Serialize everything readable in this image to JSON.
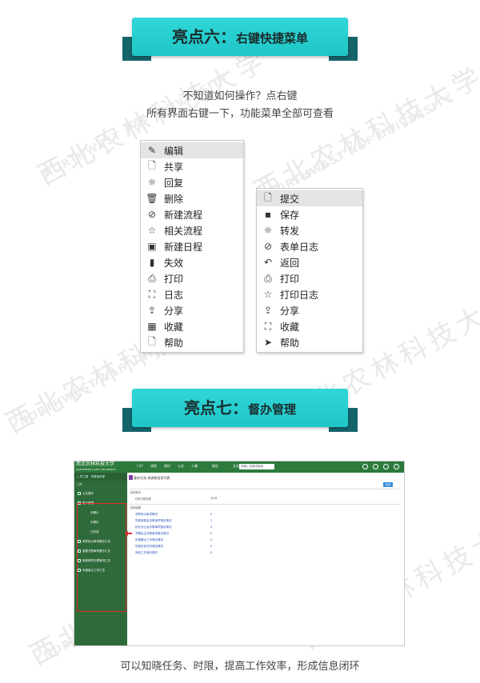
{
  "section6": {
    "title_big": "亮点六：",
    "title_small": "右键快捷菜单"
  },
  "caption6": {
    "line1": "不知道如何操作？点右键",
    "line2": "所有界面右键一下，功能菜单全部可查看"
  },
  "menu_left": [
    {
      "icon": "edit-icon",
      "glyph": "✎",
      "label": "编辑",
      "selected": true
    },
    {
      "icon": "document-icon",
      "glyph": "🗋",
      "label": "共享"
    },
    {
      "icon": "sun-icon",
      "glyph": "☼",
      "label": "回复"
    },
    {
      "icon": "trash-icon",
      "glyph": "🗑",
      "label": "删除"
    },
    {
      "icon": "tag-icon",
      "glyph": "⊘",
      "label": "新建流程"
    },
    {
      "icon": "star-icon",
      "glyph": "☆",
      "label": "相关流程"
    },
    {
      "icon": "window-icon",
      "glyph": "▣",
      "label": "新建日程"
    },
    {
      "icon": "bar-chart-icon",
      "glyph": "▮",
      "label": "失效"
    },
    {
      "icon": "printer-icon",
      "glyph": "⎙",
      "label": "打印"
    },
    {
      "icon": "log-icon",
      "glyph": "⛶",
      "label": "日志"
    },
    {
      "icon": "share-icon",
      "glyph": "⇪",
      "label": "分享"
    },
    {
      "icon": "calendar-icon",
      "glyph": "▦",
      "label": "收藏"
    },
    {
      "icon": "help-icon",
      "glyph": "🗋",
      "label": "帮助"
    }
  ],
  "menu_right": [
    {
      "icon": "submit-icon",
      "glyph": "🗋",
      "label": "提交",
      "selected": true
    },
    {
      "icon": "save-icon",
      "glyph": "▪",
      "label": "保存"
    },
    {
      "icon": "sun-icon",
      "glyph": "☼",
      "label": "转发"
    },
    {
      "icon": "tag-icon",
      "glyph": "⊘",
      "label": "表单日志"
    },
    {
      "icon": "return-icon",
      "glyph": "↶",
      "label": "返回"
    },
    {
      "icon": "printer-icon",
      "glyph": "⎙",
      "label": "打印"
    },
    {
      "icon": "star-icon",
      "glyph": "☆",
      "label": "打印日志"
    },
    {
      "icon": "share-icon",
      "glyph": "⇪",
      "label": "分享"
    },
    {
      "icon": "log-icon",
      "glyph": "⛶",
      "label": "收藏"
    },
    {
      "icon": "send-icon",
      "glyph": "➤",
      "label": "帮助"
    }
  ],
  "section7": {
    "title_big": "亮点七：",
    "title_small": "督办管理"
  },
  "app": {
    "nav": [
      "门户",
      "流程",
      "知识",
      "公文",
      "人事",
      "",
      "报告",
      "",
      "全文",
      "请输入关键词搜索"
    ],
    "side_header": "门户",
    "side_items": [
      {
        "label": "公文督办",
        "sub": false
      },
      {
        "label": "督办管理",
        "sub": false
      },
      {
        "label": "未确认",
        "sub": true
      },
      {
        "label": "办理中",
        "sub": true
      },
      {
        "label": "已完成",
        "sub": true
      },
      {
        "label": "领导批示事项督办汇总",
        "sub": false
      },
      {
        "label": "重要决策事项督办汇总",
        "sub": false
      },
      {
        "label": "网络事项办理情况汇总",
        "sub": false
      },
      {
        "label": "年度重点工作汇总",
        "sub": false
      }
    ],
    "title": "督办任务-来源按信息列表",
    "button": "查询",
    "sec1": "查询条件",
    "field_label": "任务分属年度",
    "field_value": "2018",
    "sec2": "查询结果",
    "rows": [
      {
        "label": "领导批示事项情况",
        "value": "0"
      },
      {
        "label": "党委常委会决策事项落实情况",
        "value": "3"
      },
      {
        "label": "校长办公会决策事项落实情况",
        "value": "0"
      },
      {
        "label": "专题会议决策事项落实情况",
        "value": "0"
      },
      {
        "label": "年度要点工作落实情况",
        "value": "0"
      },
      {
        "label": "年度目标任务落实情况",
        "value": "0"
      },
      {
        "label": "其他工作落实情况",
        "value": "0"
      }
    ]
  },
  "caption7": "可以知晓任务、时限，提高工作效率，形成信息闭环"
}
